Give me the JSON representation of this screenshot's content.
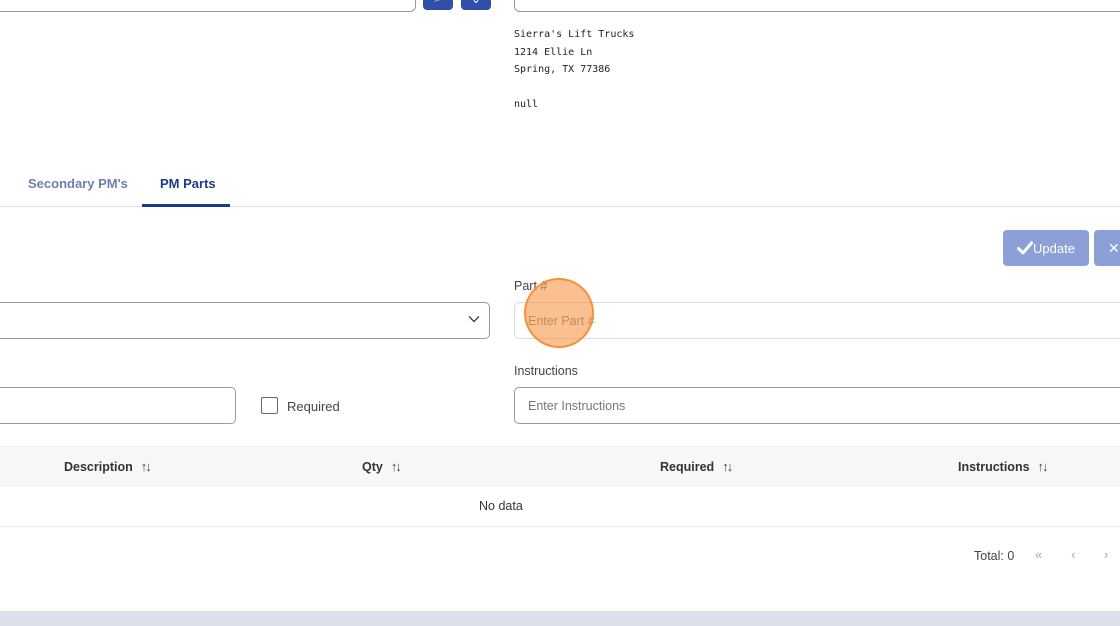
{
  "address": {
    "line1": "Sierra's Lift Trucks",
    "line2": "1214 Ellie Ln",
    "line3": "Spring, TX 77386",
    "line4": "null"
  },
  "tabs": [
    {
      "label": "Secondary PM's",
      "active": false
    },
    {
      "label": "PM Parts",
      "active": true
    }
  ],
  "actions": {
    "update_label": "Update",
    "cancel_label": "✕"
  },
  "form": {
    "part_label": "Part #",
    "part_placeholder": "Enter Part #",
    "instructions_label": "Instructions",
    "instructions_placeholder": "Enter Instructions",
    "required_label": "Required"
  },
  "table": {
    "columns": [
      "Description",
      "Qty",
      "Required",
      "Instructions"
    ],
    "empty_text": "No data"
  },
  "pagination": {
    "total_text": "Total: 0",
    "first": "«",
    "prev": "‹",
    "next": "›"
  },
  "colors": {
    "accent": "#1e3a8a",
    "button_disabled": "#8c9fd6",
    "cursor_highlight": "#f99646"
  }
}
